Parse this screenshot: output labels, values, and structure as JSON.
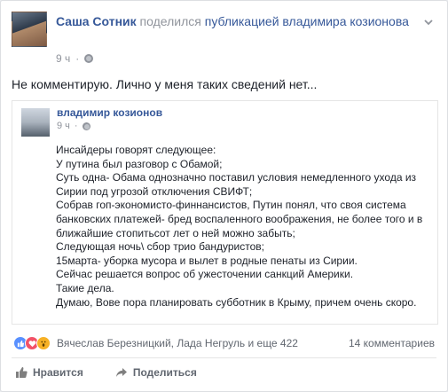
{
  "header": {
    "author": "Саша Сотник",
    "action_text": "поделился",
    "shared_link": "публикацией владимира козионова",
    "time": "9 ч",
    "separator": "·"
  },
  "post": {
    "text": "Не комментирую. Лично у меня таких сведений нет..."
  },
  "shared_post": {
    "author": "владимир козионов",
    "time": "9 ч",
    "separator": "·",
    "lines": [
      "Инсайдеры говорят следующее:",
      "У путина был разговор с Обамой;",
      "Суть одна- Обама однозначно поставил условия немедленного ухода из",
      "Сирии под угрозой отключения СВИФТ;",
      "Собрав гоп-экономисто-финнансистов, Путин понял, что своя система",
      "банковских платежей- бред воспаленного воображения, не более того и в",
      "ближайшие стопитьсот лет о ней можно забыть;",
      "Следующая ночь\\ сбор трио бандуристов;",
      "15марта- уборка мусора и вылет в родные пенаты из Сирии.",
      "Сейчас решается вопрос об ужесточении санкций Америки.",
      "Такие дела.",
      "Думаю, Вове пора планировать субботник в Крыму, причем очень скоро."
    ]
  },
  "reactions": {
    "icons": [
      "like-icon",
      "love-icon",
      "wow-icon"
    ],
    "names": "Вячеслав Березницкий, Лада Негруль и еще 422",
    "comments": "14 комментариев"
  },
  "actions": {
    "like": "Нравится",
    "share": "Поделиться"
  },
  "colors": {
    "link": "#365899",
    "meta": "#90949c",
    "like": "#5890ff",
    "love": "#f25268",
    "wow": "#f7b125"
  }
}
